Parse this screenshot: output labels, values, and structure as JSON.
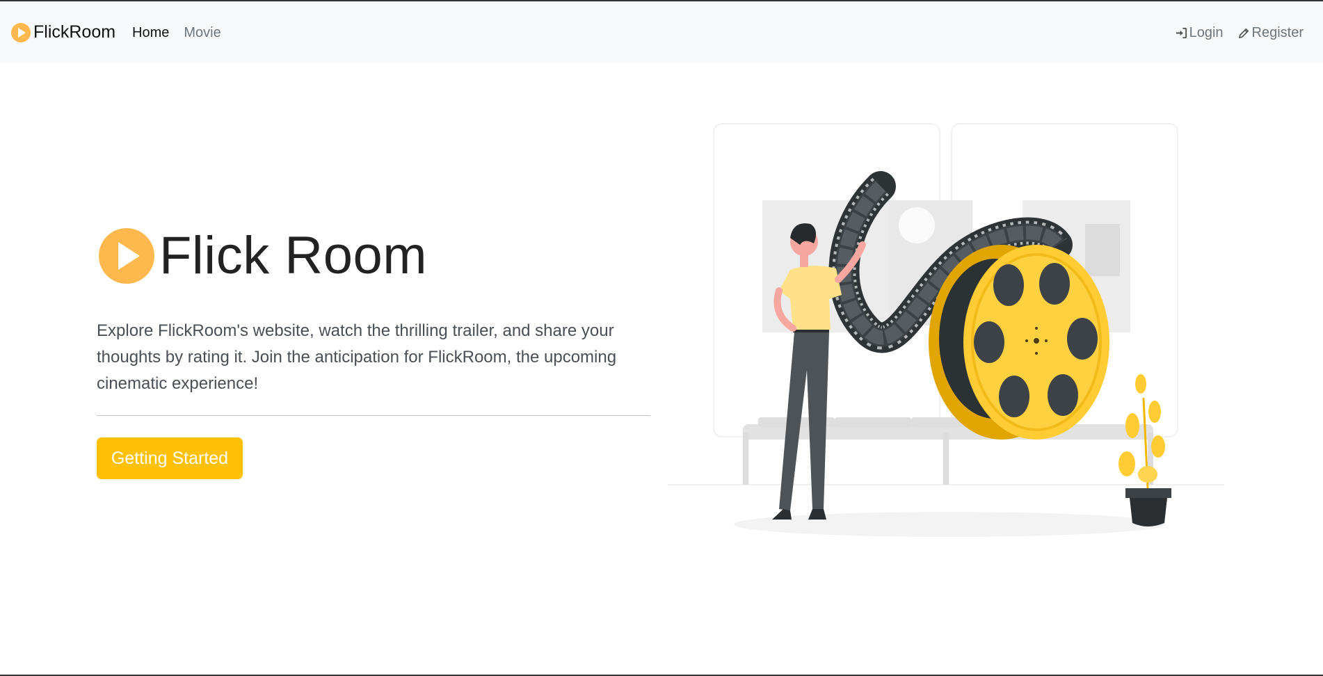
{
  "navbar": {
    "brand": "FlickRoom",
    "links": [
      {
        "label": "Home"
      },
      {
        "label": "Movie"
      }
    ],
    "auth": {
      "login_label": "Login",
      "register_label": "Register"
    }
  },
  "hero": {
    "title": "Flick Room",
    "description": "Explore FlickRoom's website, watch the thrilling trailer, and share your thoughts by rating it. Join the anticipation for FlickRoom, the upcoming cinematic experience!",
    "cta_label": "Getting Started"
  },
  "colors": {
    "accent": "#ffc107",
    "logo": "#ffb84d",
    "navbar_bg": "#f8f9fa"
  },
  "icons": {
    "brand": "play-circle-icon",
    "login": "sign-in-icon",
    "register": "pencil-icon"
  }
}
